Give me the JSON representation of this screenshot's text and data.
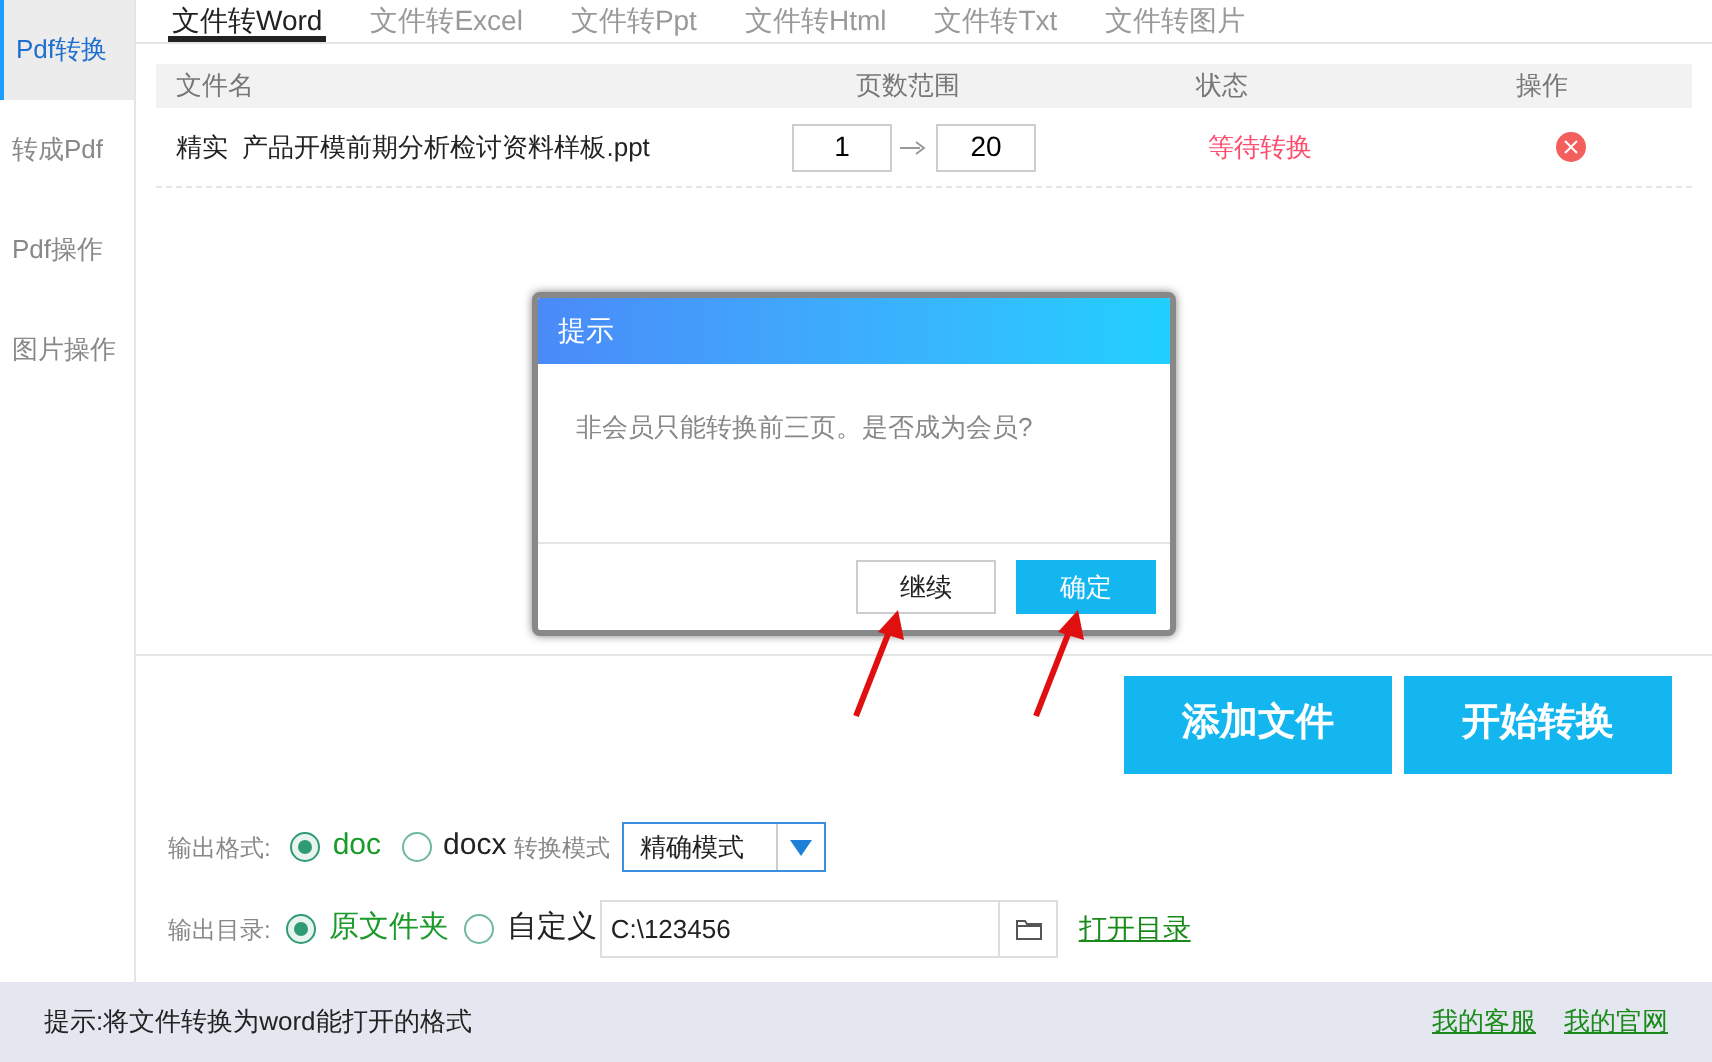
{
  "sidebar": {
    "items": [
      {
        "label": "Pdf转换",
        "selected": true
      },
      {
        "label": "转成Pdf",
        "selected": false
      },
      {
        "label": "Pdf操作",
        "selected": false
      },
      {
        "label": "图片操作",
        "selected": false
      }
    ]
  },
  "tabs": [
    {
      "label": "文件转Word",
      "selected": true
    },
    {
      "label": "文件转Excel",
      "selected": false
    },
    {
      "label": "文件转Ppt",
      "selected": false
    },
    {
      "label": "文件转Html",
      "selected": false
    },
    {
      "label": "文件转Txt",
      "selected": false
    },
    {
      "label": "文件转图片",
      "selected": false
    }
  ],
  "table": {
    "columns": [
      "文件名",
      "页数范围",
      "状态",
      "操作"
    ],
    "rows": [
      {
        "file": "精实  产品开模前期分析检讨资料样板.ppt",
        "page_from": "1",
        "page_to": "20",
        "status": "等待转换"
      }
    ]
  },
  "dialog": {
    "title": "提示",
    "message": "非会员只能转换前三页。是否成为会员?",
    "buttons": [
      {
        "label": "继续",
        "kind": "secondary"
      },
      {
        "label": "确定",
        "kind": "primary"
      }
    ]
  },
  "actions": [
    "添加文件",
    "开始转换"
  ],
  "output_format": {
    "label": "输出格式:",
    "options": [
      {
        "label": "doc",
        "selected": true
      },
      {
        "label": "docx",
        "selected": false
      }
    ],
    "mode_label": "转换模式",
    "mode_value": "精确模式"
  },
  "output_dir": {
    "label": "输出目录:",
    "options": [
      {
        "label": "原文件夹",
        "selected": true
      },
      {
        "label": "自定义",
        "selected": false
      }
    ],
    "path": "C:\\123456",
    "open_link": "打开目录"
  },
  "status_bar": {
    "hint": "提示:将文件转换为word能打开的格式",
    "links": [
      "我的客服",
      "我的官网"
    ]
  }
}
